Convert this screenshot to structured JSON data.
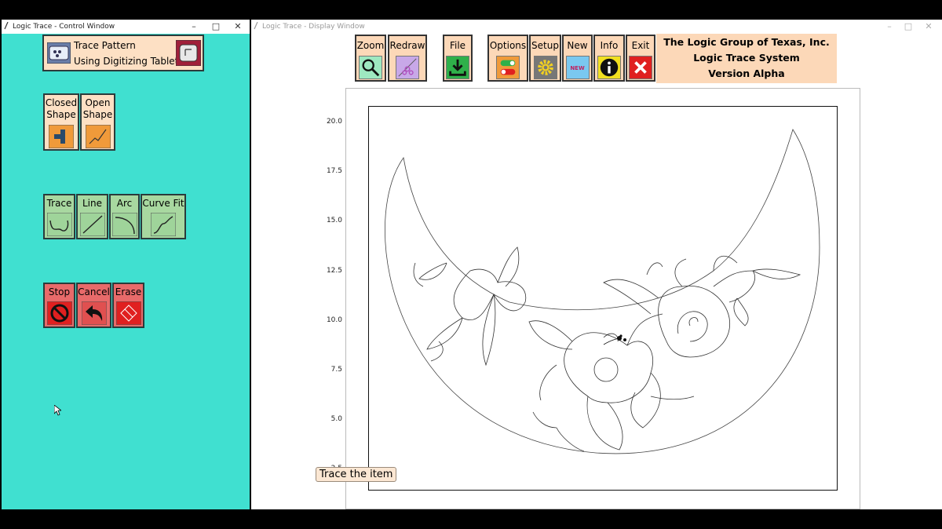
{
  "control_window": {
    "title": "Logic Trace - Control Window",
    "trace_pattern": {
      "line1": "Trace Pattern",
      "line2": "Using Digitizing Tablet"
    },
    "shape_buttons": [
      {
        "line1": "Closed",
        "line2": "Shape"
      },
      {
        "line1": "Open",
        "line2": "Shape"
      }
    ],
    "draw_buttons": [
      "Trace",
      "Line",
      "Arc",
      "Curve Fit"
    ],
    "action_buttons": [
      "Stop",
      "Cancel",
      "Erase"
    ]
  },
  "display_window": {
    "title": "Logic Trace - Display Window",
    "toolbar": [
      "Zoom",
      "Redraw",
      "File",
      "Options",
      "Setup",
      "New",
      "Info",
      "Exit"
    ],
    "new_badge": "NEW",
    "company": {
      "line1": "The Logic Group of Texas, Inc.",
      "line2": "Logic Trace System",
      "line3": "Version Alpha"
    },
    "y_ticks": [
      "20.0",
      "17.5",
      "15.0",
      "12.5",
      "10.0",
      "7.5",
      "5.0",
      "2.5"
    ],
    "tooltip": "Trace the item"
  },
  "colors": {
    "control_bg": "#40e0d0",
    "peach": "#fde0c4",
    "green": "#a8d8a0",
    "red": "#e86a6a"
  }
}
